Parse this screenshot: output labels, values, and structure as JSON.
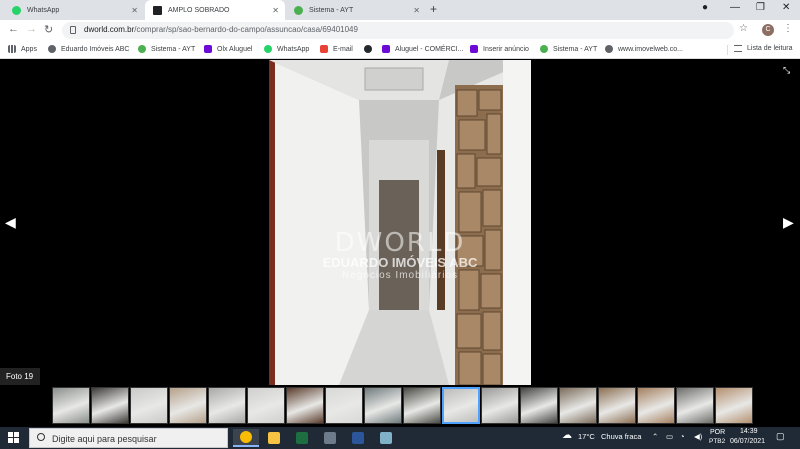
{
  "browser": {
    "tabs": [
      {
        "label": "WhatsApp",
        "active": false,
        "icon": "whatsapp-icon",
        "color": "#25d366"
      },
      {
        "label": "AMPLO SOBRADO",
        "active": true,
        "icon": "home-icon",
        "color": "#202124"
      },
      {
        "label": "Sistema - AYT",
        "active": false,
        "icon": "sistema-icon",
        "color": "#4caf50"
      }
    ],
    "tab_close": "✕",
    "new_tab": "+",
    "url_host": "dworld.com.br",
    "url_path": "/comprar/sp/sao-bernardo-do-campo/assuncao/casa/69401049",
    "avatar_letter": "C",
    "bookmarks": [
      {
        "label": "Apps",
        "icon": "apps-grid-icon",
        "color": "#5f6368"
      },
      {
        "label": "Eduardo Imóveis ABC",
        "icon": "globe-icon",
        "color": "#5f6368"
      },
      {
        "label": "Sistema - AYT",
        "icon": "sistema-icon",
        "color": "#4caf50"
      },
      {
        "label": "Olx Aluguel",
        "icon": "olx-icon",
        "color": "#6e0ad6"
      },
      {
        "label": "WhatsApp",
        "icon": "whatsapp-icon",
        "color": "#25d366"
      },
      {
        "label": "E-mail",
        "icon": "mail-icon",
        "color": "#ea4335"
      },
      {
        "label": "",
        "icon": "github-icon",
        "color": "#24292e"
      },
      {
        "label": "Aluguel - COMÉRCI...",
        "icon": "olx-icon",
        "color": "#6e0ad6"
      },
      {
        "label": "Inserir anúncio",
        "icon": "olx-icon",
        "color": "#6e0ad6"
      },
      {
        "label": "Sistema - AYT",
        "icon": "sistema-icon",
        "color": "#4caf50"
      },
      {
        "label": "www.imovelweb.co...",
        "icon": "globe-icon",
        "color": "#5f6368"
      }
    ],
    "reading_list": "Lista de leitura"
  },
  "viewer": {
    "photo_counter": "Foto 19",
    "watermark_logo": "DWORLD",
    "watermark_name": "EDUARDO IMÓVEIS ABC",
    "watermark_sub": "Negócios Imobiliários",
    "prev_arrow": "◀",
    "next_arrow": "▶",
    "expand_icon": "⤡",
    "thumbnail_colors": [
      "#8a8f8c",
      "#3d3b38",
      "#c9c9c7",
      "#b5a18a",
      "#a9a9a7",
      "#cfcfcd",
      "#5a3c2c",
      "#d8d8d6",
      "#6f7a7c",
      "#4a4a45",
      "#bdbdbd",
      "#999",
      "#444",
      "#7b6d5c",
      "#8c7054",
      "#a58060",
      "#6d6d6a",
      "#b49070"
    ],
    "selected_thumb_index": 10
  },
  "taskbar": {
    "search_placeholder": "Digite aqui para pesquisar",
    "apps": [
      {
        "icon": "chrome-icon",
        "color": "#fbbc05",
        "active": true
      },
      {
        "icon": "file-explorer-icon",
        "color": "#f6c343",
        "active": false
      },
      {
        "icon": "excel-icon",
        "color": "#1d6f42",
        "active": false
      },
      {
        "icon": "calculator-icon",
        "color": "#6e7b8b",
        "active": false
      },
      {
        "icon": "word-icon",
        "color": "#2b579a",
        "active": false
      },
      {
        "icon": "app-icon",
        "color": "#7fb2c9",
        "active": false
      }
    ],
    "weather_temp": "17°C",
    "weather_desc": "Chuva fraca",
    "lang_top": "POR",
    "lang_bottom": "PTB2",
    "time": "14:39",
    "date": "06/07/2021"
  }
}
